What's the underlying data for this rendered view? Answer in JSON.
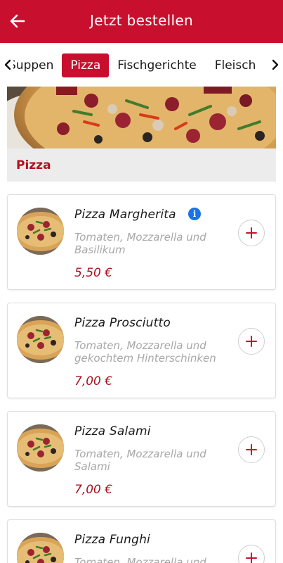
{
  "header": {
    "title": "Jetzt bestellen",
    "back_icon": "arrow-left-icon",
    "bg_color": "#c8102e"
  },
  "tabs": {
    "items": [
      "Suppen",
      "Pizza",
      "Fischgerichte",
      "Fleisch"
    ],
    "active": "Pizza",
    "accent_color": "#c8102e"
  },
  "category": {
    "title": "Pizza"
  },
  "products": [
    {
      "name": "Pizza Margherita",
      "desc": "Tomaten, Mozzarella und Basilikum",
      "price": "5,50 €",
      "has_info": true
    },
    {
      "name": "Pizza Prosciutto",
      "desc": "Tomaten, Mozzarella und gekochtem Hinterschinken",
      "price": "7,00 €",
      "has_info": false
    },
    {
      "name": "Pizza Salami",
      "desc": "Tomaten, Mozzarella und Salami",
      "price": "7,00 €",
      "has_info": false
    },
    {
      "name": "Pizza Funghi",
      "desc": "Tomaten, Mozzarella und",
      "price": "",
      "has_info": false
    }
  ],
  "info_glyph": "i",
  "add_icon": "plus-icon"
}
